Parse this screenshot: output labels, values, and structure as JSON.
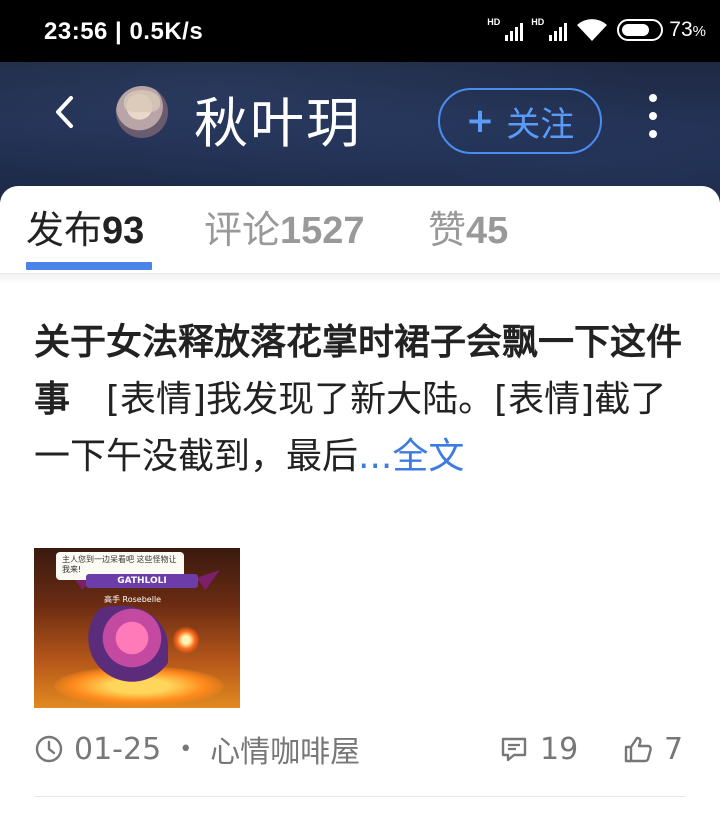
{
  "status_bar": {
    "time": "23:56",
    "network_speed": "0.5K/s",
    "sim1_label": "HD",
    "sim2_label": "HD",
    "battery_percent": "73",
    "battery_unit": "%",
    "battery_level": 0.73
  },
  "header": {
    "user_name": "秋叶玥",
    "follow_plus": "+",
    "follow_label": "关注",
    "icons": [
      "chevron-left-icon",
      "avatar",
      "more-vertical-icon"
    ]
  },
  "tabs": [
    {
      "label": "发布",
      "count": "93",
      "active": true
    },
    {
      "label": "评论",
      "count": "1527",
      "active": false
    },
    {
      "label": "赞",
      "count": "45",
      "active": false
    }
  ],
  "post": {
    "title": "关于女法释放落花掌时裙子会飘一下这件事",
    "body": "　[表情]我发现了新大陆。[表情]截了一下午没截到，最后",
    "expand_label": "...全文",
    "image_texts": {
      "bubble": "主人您到一边呆看吧 这些怪物让我来!",
      "banner": "GATHLOLI",
      "tag": "高手 Rosebelle"
    },
    "date": "01-25",
    "separator": "•",
    "board": "心情咖啡屋",
    "comments": "19",
    "likes": "7"
  },
  "colors": {
    "accent": "#4a84e8",
    "link": "#3d7be0",
    "header_bg": "#223052"
  }
}
